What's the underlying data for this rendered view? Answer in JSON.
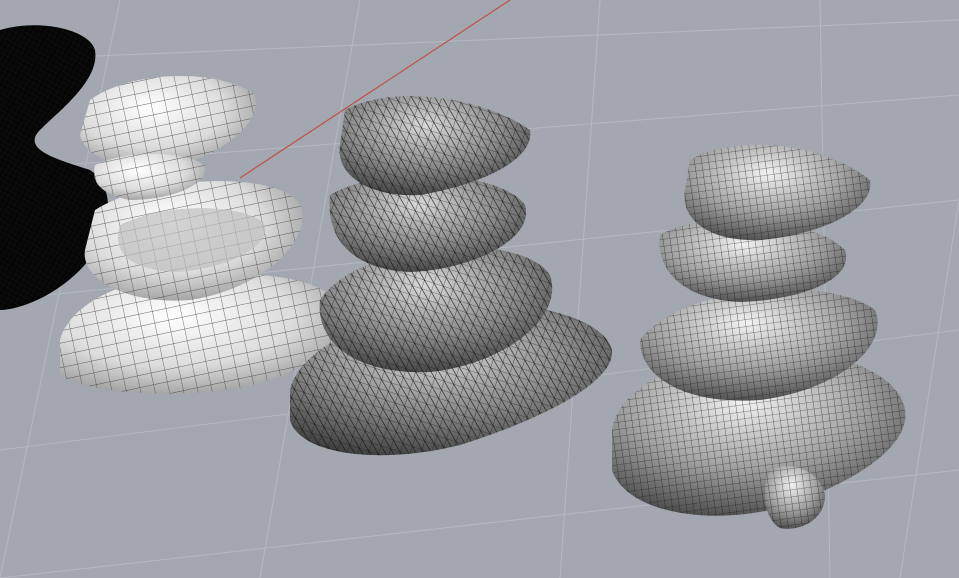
{
  "viewport": {
    "background_color": "#a3a8b0",
    "grid_color": "#b4b8bf",
    "axis_x_color": "#c0504a",
    "display_mode": "perspective"
  },
  "models": [
    {
      "id": "rendered-shaded",
      "fill": "#e6e6e6",
      "wire": "#3a3a3a"
    },
    {
      "id": "triangulated-mesh",
      "fill": "#7c7c7c",
      "wire": "#1a1a1a"
    },
    {
      "id": "quad-mesh",
      "fill": "#8a8a8a",
      "wire": "#202020"
    }
  ],
  "shadow_object_color": "#050505"
}
